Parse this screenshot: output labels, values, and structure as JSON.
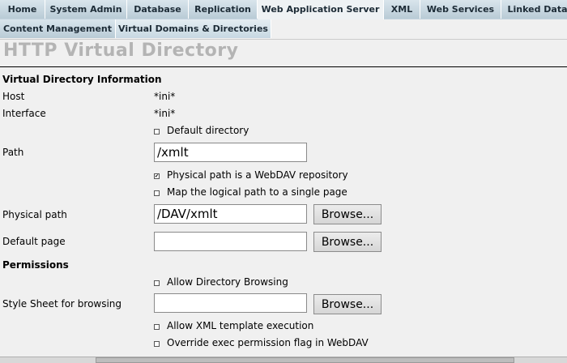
{
  "tabs": [
    {
      "label": "Home"
    },
    {
      "label": "System Admin"
    },
    {
      "label": "Database"
    },
    {
      "label": "Replication"
    },
    {
      "label": "Web Application Server",
      "active": true
    },
    {
      "label": "XML"
    },
    {
      "label": "Web Services"
    },
    {
      "label": "Linked Data"
    }
  ],
  "subtabs": [
    {
      "label": "Content Management"
    },
    {
      "label": "Virtual Domains & Directories",
      "active": true
    }
  ],
  "page_title": "HTTP Virtual Directory",
  "form": {
    "section_info": "Virtual Directory Information",
    "host_label": "Host",
    "host_value": "*ini*",
    "interface_label": "Interface",
    "interface_value": "*ini*",
    "default_directory": {
      "label": "Default directory",
      "checked": false
    },
    "path_label": "Path",
    "path_value": "/xmlt",
    "webdav_repo": {
      "label": "Physical path is a WebDAV repository",
      "checked": true
    },
    "map_single_page": {
      "label": "Map the logical path to a single page",
      "checked": false
    },
    "physical_path_label": "Physical path",
    "physical_path_value": "/DAV/xmlt",
    "browse_label": "Browse...",
    "default_page_label": "Default page",
    "default_page_value": "",
    "section_permissions": "Permissions",
    "allow_dir_browsing": {
      "label": "Allow Directory Browsing",
      "checked": false
    },
    "stylesheet_label": "Style Sheet for browsing",
    "stylesheet_value": "",
    "allow_xml_template": {
      "label": "Allow XML template execution",
      "checked": false
    },
    "override_exec": {
      "label": "Override exec permission flag in WebDAV",
      "checked": false
    }
  },
  "colors": {
    "tab_bg": "#c6d6e0",
    "active_tab_bg": "#eef2f4",
    "page_bg": "#f0f0f0",
    "title_color": "#b4b4b4"
  }
}
